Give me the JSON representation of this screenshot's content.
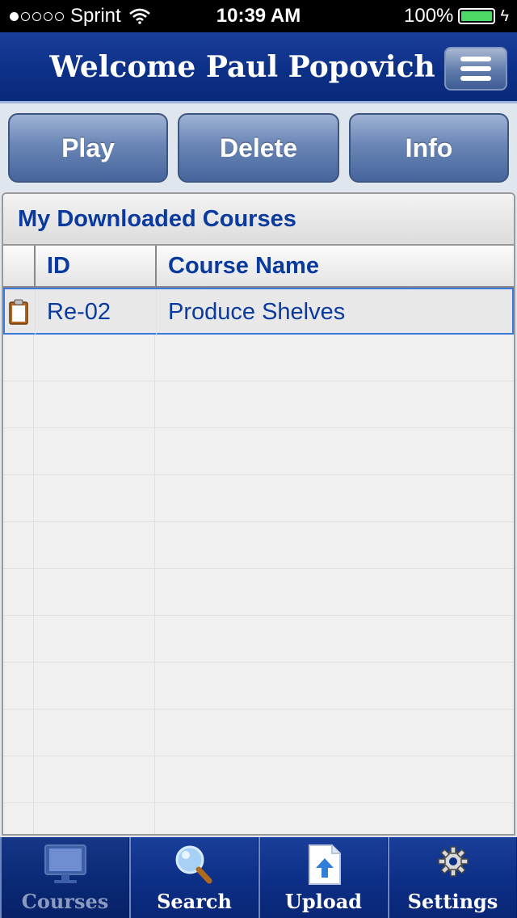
{
  "status_bar": {
    "carrier": "Sprint",
    "time": "10:39 AM",
    "battery": "100%"
  },
  "header": {
    "title": "Welcome Paul Popovich"
  },
  "actions": {
    "play_label": "Play",
    "delete_label": "Delete",
    "info_label": "Info"
  },
  "panel": {
    "title": "My Downloaded Courses",
    "columns": [
      "",
      "ID",
      "Course Name"
    ],
    "rows": [
      {
        "id": "Re-02",
        "course_name": "Produce Shelves"
      }
    ]
  },
  "tabbar": {
    "tabs": [
      {
        "label": "Courses",
        "icon": "monitor-icon",
        "active": true
      },
      {
        "label": "Search",
        "icon": "magnifier-icon",
        "active": false
      },
      {
        "label": "Upload",
        "icon": "upload-icon",
        "active": false
      },
      {
        "label": "Settings",
        "icon": "gear-icon",
        "active": false
      }
    ]
  },
  "colors": {
    "header_blue": "#0c2f86",
    "text_blue": "#0a3a9e",
    "selection_border": "#3c78d8",
    "battery_green": "#4cd964"
  }
}
